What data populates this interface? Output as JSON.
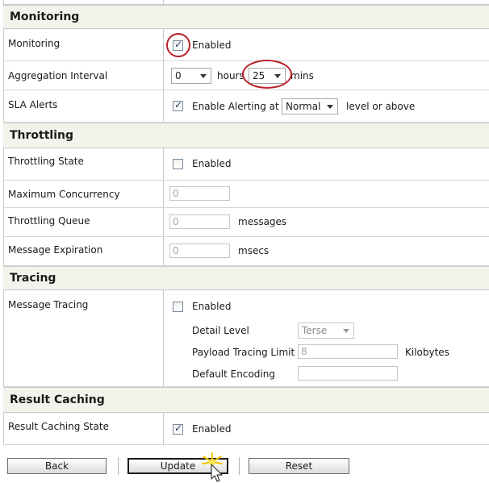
{
  "sections": {
    "monitoring": "Monitoring",
    "throttling": "Throttling",
    "tracing": "Tracing",
    "result_caching": "Result Caching"
  },
  "monitoring": {
    "label": "Monitoring",
    "enabled_label": "Enabled",
    "enabled": true,
    "aggregation": {
      "label": "Aggregation Interval",
      "hours_value": "0",
      "hours_unit": "hours",
      "mins_value": "25",
      "mins_unit": "mins"
    },
    "sla": {
      "label": "SLA Alerts",
      "checkbox_label": "Enable Alerting at",
      "checked": true,
      "level_value": "Normal",
      "suffix": "level or above"
    }
  },
  "throttling": {
    "state_label": "Throttling State",
    "state_checkbox_label": "Enabled",
    "state_checked": false,
    "max_concurrency_label": "Maximum Concurrency",
    "max_concurrency_value": "0",
    "queue_label": "Throttling Queue",
    "queue_value": "0",
    "queue_unit": "messages",
    "expiration_label": "Message Expiration",
    "expiration_value": "0",
    "expiration_unit": "msecs"
  },
  "tracing": {
    "label": "Message Tracing",
    "checkbox_label": "Enabled",
    "checked": false,
    "detail_level_label": "Detail Level",
    "detail_level_value": "Terse",
    "payload_limit_label": "Payload Tracing Limit",
    "payload_limit_value": "8",
    "payload_limit_unit": "Kilobytes",
    "encoding_label": "Default Encoding",
    "encoding_value": ""
  },
  "result_caching": {
    "label": "Result Caching State",
    "checkbox_label": "Enabled",
    "checked": true
  },
  "buttons": {
    "back": "Back",
    "update": "Update",
    "reset": "Reset"
  },
  "colors": {
    "section_bg": "#f3f3ec",
    "highlight_circle": "#b8202a",
    "border": "#c9c9c9"
  }
}
